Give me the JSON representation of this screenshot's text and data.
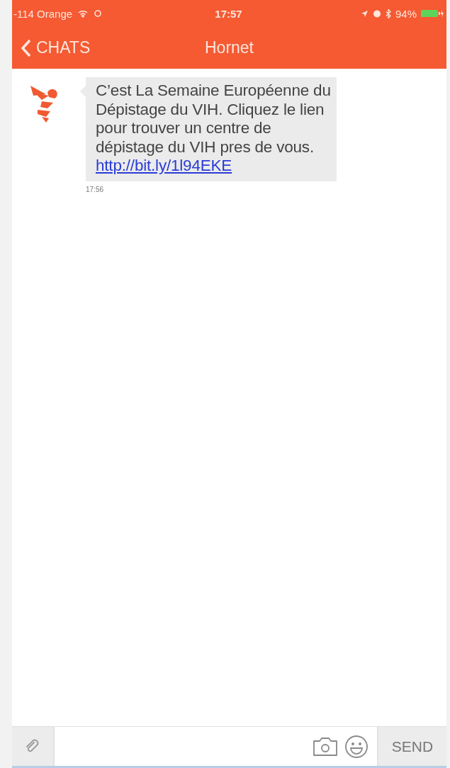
{
  "status_bar": {
    "carrier": "-114 Orange",
    "time": "17:57",
    "battery": "94%"
  },
  "nav": {
    "back": "CHATS",
    "title": "Hornet"
  },
  "messages": [
    {
      "text": "C’est La Semaine Européenne du Dépistage du VIH. Cliquez le lien pour trouver un centre de dépistage du VIH pres de vous. ",
      "link": "http://bit.ly/1l94EKE",
      "time": "17:56"
    }
  ],
  "composer": {
    "send": "SEND"
  }
}
